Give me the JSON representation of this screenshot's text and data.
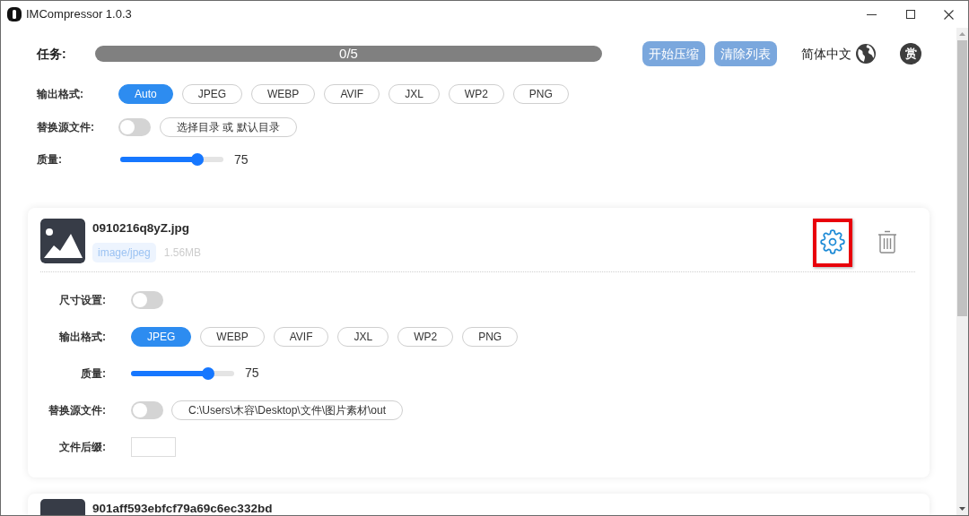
{
  "window": {
    "title": "IMCompressor 1.0.3"
  },
  "toolbar": {
    "task_label": "任务:",
    "progress": {
      "text": "0/5",
      "level": 0
    },
    "buttons": [
      "开始压缩",
      "清除列表"
    ],
    "language": "简体中文",
    "reward_button": "赏"
  },
  "global_settings": {
    "format_label": "输出格式:",
    "formats": [
      {
        "label": "Auto",
        "selected": true
      },
      {
        "label": "JPEG",
        "selected": false
      },
      {
        "label": "WEBP",
        "selected": false
      },
      {
        "label": "AVIF",
        "selected": false
      },
      {
        "label": "JXL",
        "selected": false
      },
      {
        "label": "WP2",
        "selected": false
      },
      {
        "label": "PNG",
        "selected": false
      }
    ],
    "replace_label": "替换源文件:",
    "replace_on": false,
    "directory_button": "选择目录 或 默认目录",
    "quality_label": "质量:",
    "quality": {
      "level": 0.75,
      "reading": "75"
    }
  },
  "files": [
    {
      "kind": "full",
      "name": "0910216q8yZ.jpg",
      "mime": "image/jpeg",
      "size": "1.56MB",
      "highlighted": true,
      "settings": [
        {
          "kind": "toggle",
          "label": "尺寸设置:",
          "on": false
        },
        {
          "kind": "formats",
          "label": "输出格式:",
          "options": [
            {
              "label": "JPEG",
              "selected": true
            },
            {
              "label": "WEBP",
              "selected": false
            },
            {
              "label": "AVIF",
              "selected": false
            },
            {
              "label": "JXL",
              "selected": false
            },
            {
              "label": "WP2",
              "selected": false
            },
            {
              "label": "PNG",
              "selected": false
            }
          ]
        },
        {
          "kind": "slider",
          "label": "质量:",
          "level": 0.75,
          "reading": "75"
        },
        {
          "kind": "path",
          "label": "替换源文件:",
          "on": false,
          "path": "C:\\Users\\木容\\Desktop\\文件\\图片素材\\out"
        },
        {
          "kind": "input",
          "label": "文件后缀:"
        }
      ]
    },
    {
      "kind": "partial",
      "name": "901aff593ebfcf79a69c6ec332bd"
    }
  ]
}
